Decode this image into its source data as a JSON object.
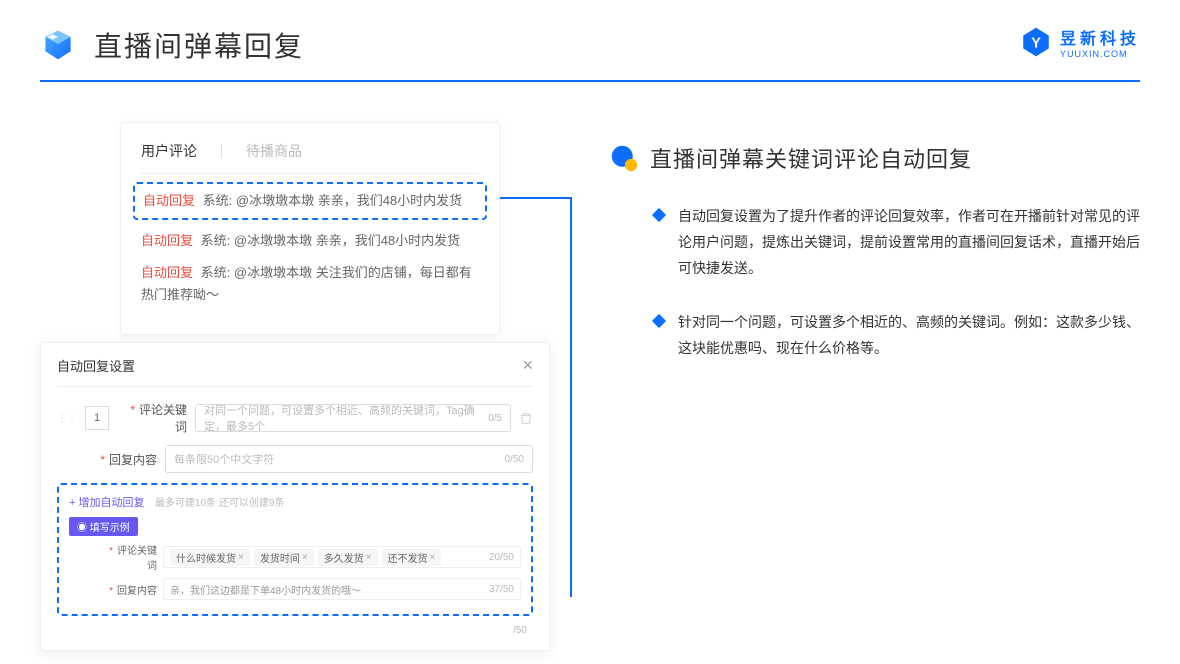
{
  "header": {
    "title": "直播间弹幕回复"
  },
  "brand": {
    "name": "昱新科技",
    "url": "YUUXIN.COM"
  },
  "card1": {
    "tab1": "用户评论",
    "tab2": "待播商品",
    "tag": "自动回复",
    "sys_prefix": "系统:",
    "c1": "@冰墩墩本墩 亲亲，我们48小时内发货",
    "c2": "@冰墩墩本墩 亲亲，我们48小时内发货",
    "c3": "@冰墩墩本墩 关注我们的店铺，每日都有热门推荐呦～"
  },
  "card2": {
    "title": "自动回复设置",
    "order": "1",
    "label_kw": "评论关键词",
    "ph_kw": "对同一个问题，可设置多个相近、高频的关键词，Tag确定，最多5个",
    "count_kw": "0/5",
    "label_content": "回复内容",
    "ph_content": "每条限50个中文字符",
    "count_content": "0/50",
    "add": "+ 增加自动回复",
    "add_hint": "最多可建10条 还可以创建9条",
    "badge": "◉ 填写示例",
    "ex_label_kw": "评论关键词",
    "ex_tags": [
      "什么时候发货",
      "发货时间",
      "多久发货",
      "还不发货"
    ],
    "ex_count_kw": "20/50",
    "ex_label_content": "回复内容",
    "ex_content": "亲，我们这边都是下单48小时内发货的哦～",
    "ex_count_content": "37/50",
    "extra_count": "/50"
  },
  "right": {
    "title": "直播间弹幕关键词评论自动回复",
    "b1": "自动回复设置为了提升作者的评论回复效率，作者可在开播前针对常见的评论用户问题，提炼出关键词，提前设置常用的直播间回复话术，直播开始后可快捷发送。",
    "b2": "针对同一个问题，可设置多个相近的、高频的关键词。例如：这款多少钱、这块能优惠吗、现在什么价格等。"
  }
}
